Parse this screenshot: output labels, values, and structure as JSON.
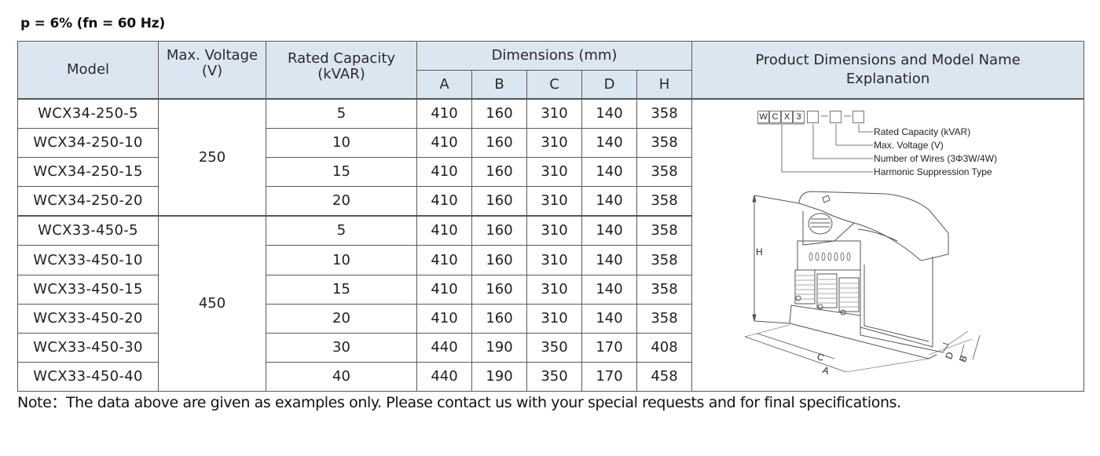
{
  "subtitle": "p = 6% (fn = 60 Hz)",
  "table": {
    "headers": {
      "model": "Model",
      "max_voltage_line1": "Max. Voltage",
      "max_voltage_line2": "(V)",
      "rated_capacity_line1": "Rated Capacity",
      "rated_capacity_line2": "(kVAR)",
      "dimensions": "Dimensions (mm)",
      "dim_a": "A",
      "dim_b": "B",
      "dim_c": "C",
      "dim_d": "D",
      "dim_h": "H",
      "product_line1": "Product Dimensions and Model Name",
      "product_line2": "Explanation"
    },
    "voltage_groups": [
      "250",
      "450"
    ],
    "rows": [
      {
        "model": "WCX34-250-5",
        "capacity": "5",
        "A": "410",
        "B": "160",
        "C": "310",
        "D": "140",
        "H": "358"
      },
      {
        "model": "WCX34-250-10",
        "capacity": "10",
        "A": "410",
        "B": "160",
        "C": "310",
        "D": "140",
        "H": "358"
      },
      {
        "model": "WCX34-250-15",
        "capacity": "15",
        "A": "410",
        "B": "160",
        "C": "310",
        "D": "140",
        "H": "358"
      },
      {
        "model": "WCX34-250-20",
        "capacity": "20",
        "A": "410",
        "B": "160",
        "C": "310",
        "D": "140",
        "H": "358"
      },
      {
        "model": "WCX33-450-5",
        "capacity": "5",
        "A": "410",
        "B": "160",
        "C": "310",
        "D": "140",
        "H": "358"
      },
      {
        "model": "WCX33-450-10",
        "capacity": "10",
        "A": "410",
        "B": "160",
        "C": "310",
        "D": "140",
        "H": "358"
      },
      {
        "model": "WCX33-450-15",
        "capacity": "15",
        "A": "410",
        "B": "160",
        "C": "310",
        "D": "140",
        "H": "358"
      },
      {
        "model": "WCX33-450-20",
        "capacity": "20",
        "A": "410",
        "B": "160",
        "C": "310",
        "D": "140",
        "H": "358"
      },
      {
        "model": "WCX33-450-30",
        "capacity": "30",
        "A": "440",
        "B": "190",
        "C": "350",
        "D": "170",
        "H": "408"
      },
      {
        "model": "WCX33-450-40",
        "capacity": "40",
        "A": "440",
        "B": "190",
        "C": "350",
        "D": "170",
        "H": "458"
      }
    ]
  },
  "model_code": {
    "boxes": [
      "W",
      "C",
      "X",
      "3"
    ],
    "separator": "-",
    "labels": {
      "rated_capacity": "Rated Capacity (kVAR)",
      "max_voltage": "Max. Voltage (V)",
      "wires": "Number of Wires (3Φ3W/4W)",
      "harmonic": "Harmonic Suppression Type"
    }
  },
  "drawing_labels": {
    "H": "H",
    "A": "A",
    "B": "B",
    "C": "C",
    "D": "D"
  },
  "colors": {
    "header_bg": "#dce6f0",
    "border": "#5a5a5a"
  },
  "note": "Note：The data above are given as examples only. Please contact us with your special requests and for final specifications."
}
